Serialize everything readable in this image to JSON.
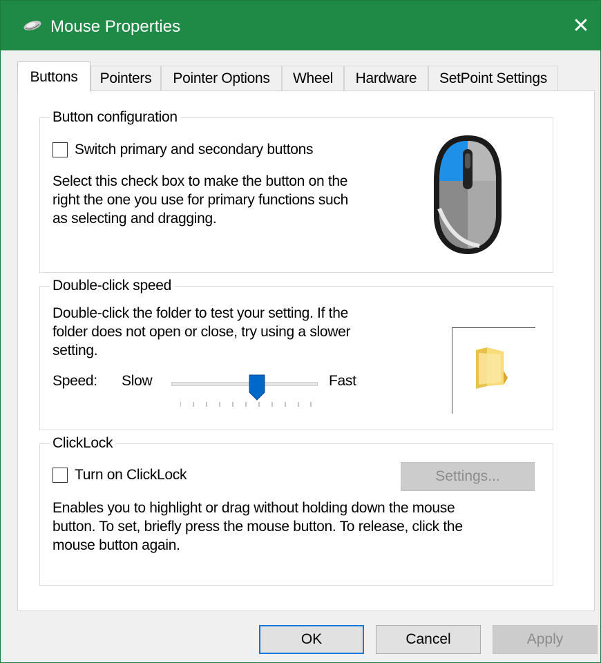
{
  "window": {
    "title": "Mouse Properties",
    "close_glyph": "✕",
    "accent_color": "#1f8a45"
  },
  "tabs": [
    {
      "label": "Buttons",
      "active": true
    },
    {
      "label": "Pointers",
      "active": false
    },
    {
      "label": "Pointer Options",
      "active": false
    },
    {
      "label": "Wheel",
      "active": false
    },
    {
      "label": "Hardware",
      "active": false
    },
    {
      "label": "SetPoint Settings",
      "active": false
    }
  ],
  "button_config": {
    "legend": "Button configuration",
    "checkbox_label": "Switch primary and secondary buttons",
    "checked": false,
    "desc_lines": [
      "Select this check box to make the button on the",
      "right the one you use for primary functions such",
      "as selecting and dragging."
    ],
    "mouse_icon": "mouse-icon",
    "highlight_color": "#1e90e8"
  },
  "double_click": {
    "legend": "Double-click speed",
    "desc_lines": [
      "Double-click the folder to test your setting. If the",
      "folder does not open or close, try using a slower",
      "setting."
    ],
    "speed_label": "Speed:",
    "slow_label": "Slow",
    "fast_label": "Fast",
    "slider_value": 0.6,
    "folder_icon": "folder-icon"
  },
  "clicklock": {
    "legend": "ClickLock",
    "checkbox_label": "Turn on ClickLock",
    "checked": false,
    "settings_label": "Settings...",
    "settings_enabled": false,
    "desc_lines": [
      "Enables you to highlight or drag without holding down the mouse",
      "button. To set, briefly press the mouse button. To release, click the",
      "mouse button again."
    ]
  },
  "footer": {
    "ok_label": "OK",
    "cancel_label": "Cancel",
    "apply_label": "Apply",
    "apply_enabled": false,
    "focus_color": "#0078d7"
  }
}
